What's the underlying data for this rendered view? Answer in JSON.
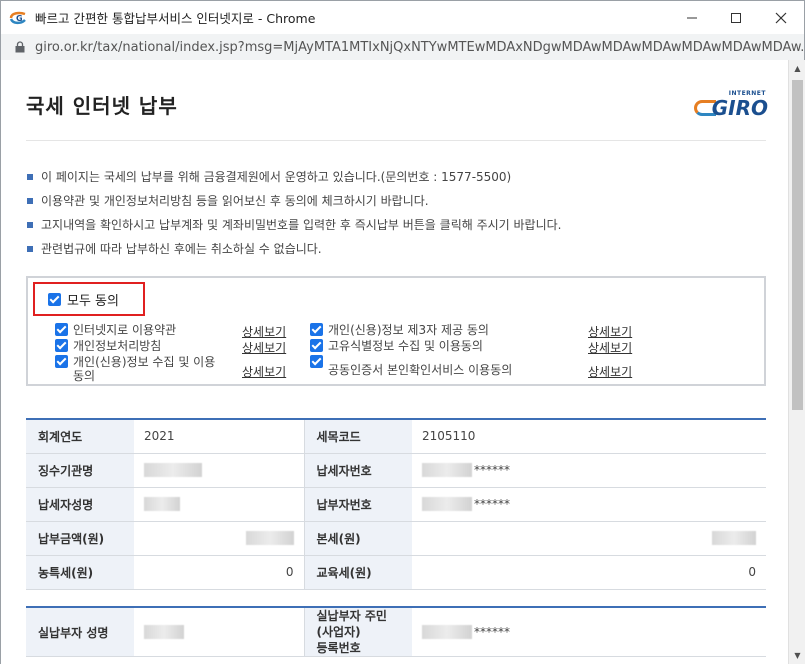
{
  "window": {
    "title": "빠르고 간편한 통합납부서비스 인터넷지로 - Chrome",
    "url": "giro.or.kr/tax/national/index.jsp?msg=MjAyMTA1MTIxNjQxNTYwMTEwMDAxNDgwMDAwMDAwMDAwMDAwMDAwMDAw..."
  },
  "page": {
    "title": "국세 인터넷 납부",
    "logo_small": "INTERNET",
    "logo_big": "GIRO"
  },
  "notices": [
    "이 페이지는 국세의 납부를 위해 금융결제원에서 운영하고 있습니다.(문의번호 : 1577-5500)",
    "이용약관 및 개인정보처리방침 등을 읽어보신 후 동의에 체크하시기 바랍니다.",
    "고지내역을 확인하시고 납부계좌 및 계좌비밀번호를 입력한 후 즉시납부 버튼을 클릭해 주시기 바랍니다.",
    "관련법규에 따라 납부하신 후에는 취소하실 수 없습니다."
  ],
  "agree": {
    "all_label": "모두 동의",
    "detail_label": "상세보기",
    "left_terms": [
      "인터넷지로 이용약관",
      "개인정보처리방침",
      "개인(신용)정보 수집 및 이용",
      "동의"
    ],
    "right_terms": [
      "개인(신용)정보 제3자 제공 동의",
      "고유식별정보 수집 및 이용동의",
      "공동인증서 본인확인서비스 이용동의"
    ]
  },
  "info_table": {
    "rows": [
      {
        "l_label": "회계연도",
        "l_value": "2021",
        "r_label": "세목코드",
        "r_value": "2105110"
      },
      {
        "l_label": "징수기관명",
        "l_value": "",
        "r_label": "납세자번호",
        "r_value": "******"
      },
      {
        "l_label": "납세자성명",
        "l_value": "",
        "r_label": "납부자번호",
        "r_value": "******"
      },
      {
        "l_label": "납부금액(원)",
        "l_value": "",
        "r_label": "본세(원)",
        "r_value": ""
      },
      {
        "l_label": "농특세(원)",
        "l_value": "0",
        "r_label": "교육세(원)",
        "r_value": "0"
      }
    ]
  },
  "payer_table": {
    "l_label": "실납부자 성명",
    "r_label_1": "실납부자 주민(사업자)",
    "r_label_2": "등록번호",
    "r_value": "******"
  },
  "colors": {
    "accent": "#3e6fb6",
    "highlight_border": "#e02020",
    "checkbox": "#1a73e8",
    "logo_blue": "#1b4f8f",
    "logo_orange": "#e67e22"
  }
}
